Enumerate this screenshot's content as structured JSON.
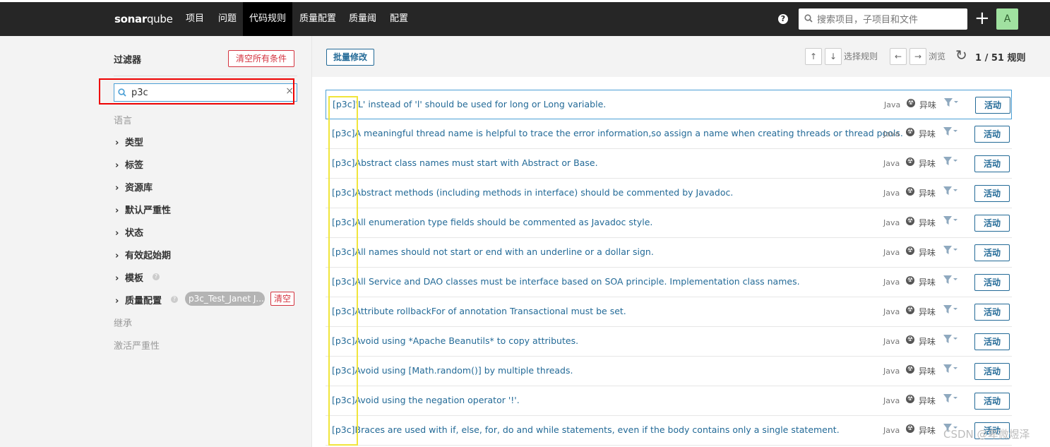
{
  "topnav": {
    "logo_bold": "sonar",
    "logo_rest": "qube",
    "items": [
      {
        "label": "项目"
      },
      {
        "label": "问题"
      },
      {
        "label": "代码规则"
      },
      {
        "label": "质量配置"
      },
      {
        "label": "质量阈"
      },
      {
        "label": "配置"
      }
    ],
    "help_icon": "?",
    "search_placeholder": "搜索项目，子项目和文件",
    "plus_icon": "+",
    "avatar_initial": "A"
  },
  "sidebar": {
    "title": "过滤器",
    "clear_all": "清空所有条件",
    "search_value": "p3c",
    "search_clear": "×",
    "facets": [
      {
        "label": "语言",
        "disabled": true
      },
      {
        "label": "类型"
      },
      {
        "label": "标签"
      },
      {
        "label": "资源库"
      },
      {
        "label": "默认严重性"
      },
      {
        "label": "状态"
      },
      {
        "label": "有效起始期"
      },
      {
        "label": "模板"
      },
      {
        "label": "质量配置"
      },
      {
        "label": "继承",
        "disabled": true
      },
      {
        "label": "激活严重性",
        "disabled": true
      }
    ],
    "quality_profile_value": "p3c_Test_Janet J...",
    "quality_profile_clear": "清空"
  },
  "toolbar": {
    "bulk_change": "批量修改",
    "up_arrow": "↑",
    "down_arrow": "↓",
    "select_rule": "选择规则",
    "left_arrow": "←",
    "right_arrow": "→",
    "browse": "浏览",
    "reload_icon": "↻",
    "count": "1 / 51 规则"
  },
  "rules": [
    {
      "title": "[p3c]'L' instead of 'l' should be used for long or Long variable.",
      "lang": "Java",
      "type": "异味",
      "status": "活动"
    },
    {
      "title": "[p3c]A meaningful thread name is helpful to trace the error information,so assign a name when creating threads or thread pools.",
      "lang": "Java",
      "type": "异味",
      "status": "活动"
    },
    {
      "title": "[p3c]Abstract class names must start with Abstract or Base.",
      "lang": "Java",
      "type": "异味",
      "status": "活动"
    },
    {
      "title": "[p3c]Abstract methods (including methods in interface) should be commented by Javadoc.",
      "lang": "Java",
      "type": "异味",
      "status": "活动"
    },
    {
      "title": "[p3c]All enumeration type fields should be commented as Javadoc style.",
      "lang": "Java",
      "type": "异味",
      "status": "活动"
    },
    {
      "title": "[p3c]All names should not start or end with an underline or a dollar sign.",
      "lang": "Java",
      "type": "异味",
      "status": "活动"
    },
    {
      "title": "[p3c]All Service and DAO classes must be interface based on SOA principle. Implementation class names.",
      "lang": "Java",
      "type": "异味",
      "status": "活动"
    },
    {
      "title": "[p3c]Attribute rollbackFor of annotation Transactional must be set.",
      "lang": "Java",
      "type": "异味",
      "status": "活动"
    },
    {
      "title": "[p3c]Avoid using *Apache Beanutils* to copy attributes.",
      "lang": "Java",
      "type": "异味",
      "status": "活动"
    },
    {
      "title": "[p3c]Avoid using [Math.random()] by multiple threads.",
      "lang": "Java",
      "type": "异味",
      "status": "活动"
    },
    {
      "title": "[p3c]Avoid using the negation operator '!'.",
      "lang": "Java",
      "type": "异味",
      "status": "活动"
    },
    {
      "title": "[p3c]Braces are used with if, else, for, do and while statements, even if the body contains only a single statement.",
      "lang": "Java",
      "type": "异味",
      "status": "活动"
    }
  ],
  "watermark": "CSDN @卑微煜泽",
  "colors": {
    "accent": "#236a97",
    "danger": "#d4333f",
    "topbar": "#262626",
    "highlight": "#4b9fd5"
  }
}
